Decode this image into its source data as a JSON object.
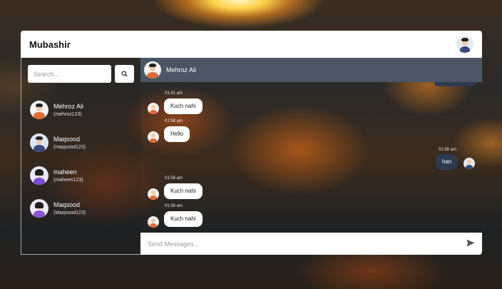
{
  "app": {
    "user_name": "Mubashir"
  },
  "search": {
    "placeholder": "Search..."
  },
  "icons": {
    "search": "search-icon",
    "send": "send-icon"
  },
  "contacts": [
    {
      "name": "Mehroz Ali",
      "handle": "(mehroz123)",
      "avatar_body": "#e06b3a",
      "avatar_bg": "#f3f3f3"
    },
    {
      "name": "Maqsood",
      "handle": "(maqsood123)",
      "avatar_body": "#3b4a7a",
      "avatar_bg": "#dfe6f5"
    },
    {
      "name": "maheen",
      "handle": "(maheen123)",
      "avatar_body": "#7a4bd1",
      "avatar_bg": "#ece8f7"
    },
    {
      "name": "Maqsood",
      "handle": "(Maqsood123)",
      "avatar_body": "#8c55d6",
      "avatar_bg": "#ece8f7"
    }
  ],
  "chat": {
    "active_contact": "Mehroz Ali",
    "messages": [
      {
        "text": "Kuch nahi",
        "time": "01:41 am",
        "from": "them"
      },
      {
        "text": "Hello",
        "time": "01:58 am",
        "from": "them"
      },
      {
        "text": "han",
        "time": "01:58 am",
        "from": "me"
      },
      {
        "text": "Kuch nahi",
        "time": "01:58 am",
        "from": "them"
      },
      {
        "text": "Kuch nahi",
        "time": "01:58 am",
        "from": "them"
      }
    ]
  },
  "composer": {
    "placeholder": "Send Messages..."
  },
  "colors": {
    "chat_header": "#4c5564",
    "my_bubble": "#2f3a4f",
    "their_bubble": "#ffffff"
  }
}
